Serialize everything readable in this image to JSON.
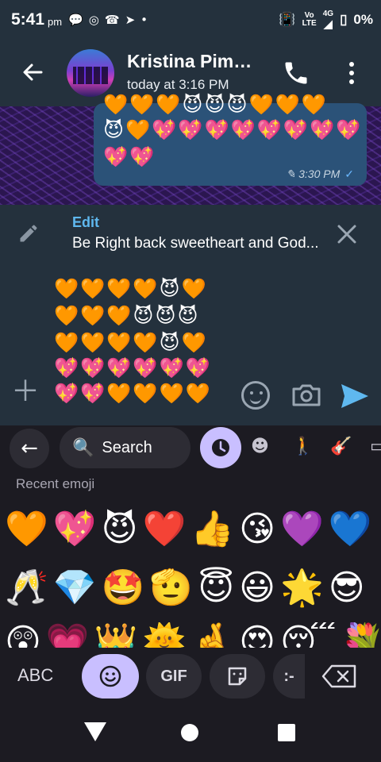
{
  "status_bar": {
    "time": "5:41",
    "ampm": "pm",
    "battery": "0%",
    "net_top": "Vo",
    "net_bottom": "LTE",
    "signal": "4G"
  },
  "chat_header": {
    "contact_name": "Kristina Pim…",
    "last_seen": "today at 3:16 PM"
  },
  "sent_message": {
    "rows": [
      "🧡🧡🧡😈😈😈🧡🧡🧡",
      "😈🧡💖💖💖💖💖💖💖💖",
      "💖💖"
    ],
    "time": "3:30 PM"
  },
  "edit_bar": {
    "title": "Edit",
    "text": "Be Right back sweetheart and God..."
  },
  "compose": {
    "rows": [
      "🧡🧡🧡🧡😈🧡",
      "🧡🧡🧡😈😈😈",
      "🧡🧡🧡🧡😈🧡",
      "💖💖💖💖💖💖",
      "💖💖🧡🧡🧡🧡"
    ]
  },
  "keyboard": {
    "search_label": "Search",
    "section_title": "Recent emoji",
    "emoji_rows": [
      [
        "🧡",
        "💖",
        "😈",
        "❤️",
        "👍",
        "😘",
        "💜",
        "💙"
      ],
      [
        "🥂",
        "💎",
        "🤩",
        "🫡",
        "😇",
        "😃",
        "🌟",
        "😎"
      ],
      [
        "😲",
        "💗",
        "👑",
        "🌞",
        "🤞",
        "😍",
        "😴",
        "💐"
      ]
    ],
    "abc_label": "ABC",
    "gif_label": "GIF"
  }
}
